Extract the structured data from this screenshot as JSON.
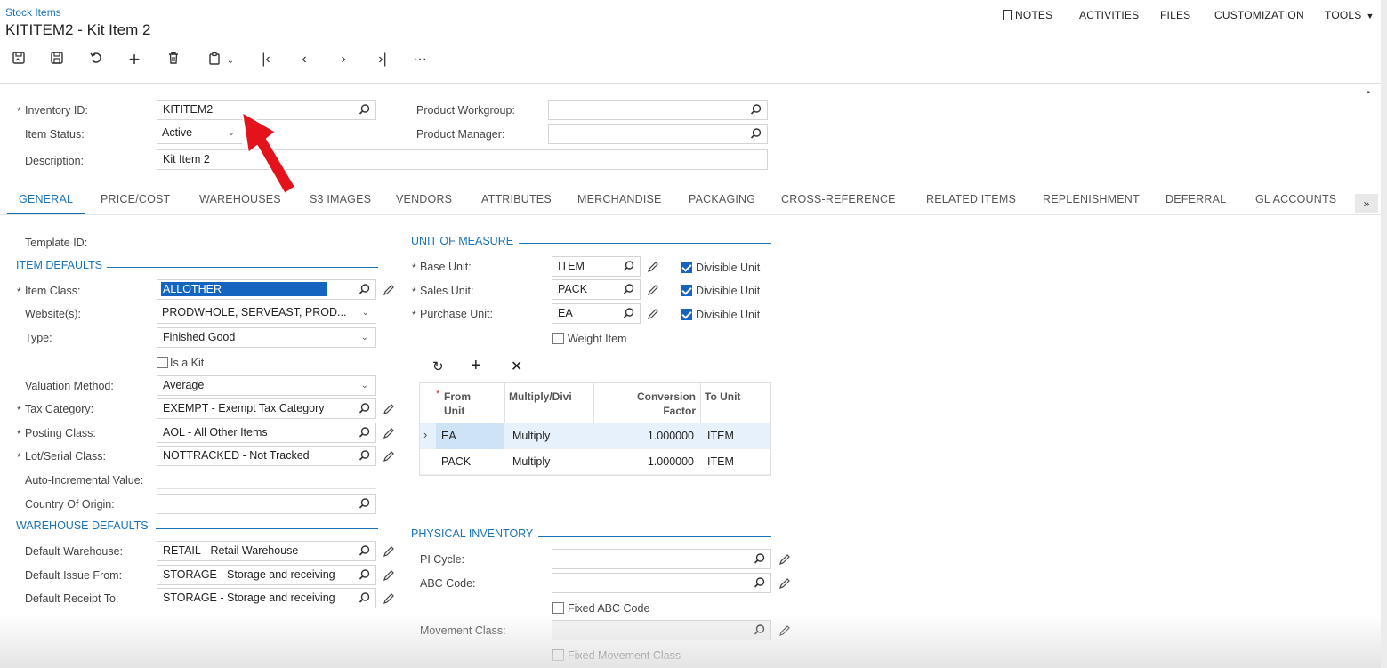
{
  "header": {
    "breadcrumb": "Stock Items",
    "title": "KITITEM2 - Kit Item 2",
    "menu": {
      "notes": "NOTES",
      "activities": "ACTIVITIES",
      "files": "FILES",
      "customization": "CUSTOMIZATION",
      "tools": "TOOLS"
    }
  },
  "summary": {
    "inventory_id_label": "Inventory ID:",
    "inventory_id": "KITITEM2",
    "item_status_label": "Item Status:",
    "item_status": "Active",
    "description_label": "Description:",
    "description": "Kit Item 2",
    "product_workgroup_label": "Product Workgroup:",
    "product_workgroup": "",
    "product_manager_label": "Product Manager:",
    "product_manager": ""
  },
  "tabs": [
    "GENERAL",
    "PRICE/COST",
    "WAREHOUSES",
    "S3 IMAGES",
    "VENDORS",
    "ATTRIBUTES",
    "MERCHANDISE",
    "PACKAGING",
    "CROSS-REFERENCE",
    "RELATED ITEMS",
    "REPLENISHMENT",
    "DEFERRAL",
    "GL ACCOUNTS"
  ],
  "general": {
    "template_id_label": "Template ID:",
    "item_defaults_title": "ITEM DEFAULTS",
    "item_class_label": "Item Class:",
    "item_class": "ALLOTHER",
    "websites_label": "Website(s):",
    "websites": "PRODWHOLE, SERVEAST, PROD...",
    "type_label": "Type:",
    "type": "Finished Good",
    "is_kit_label": "Is a Kit",
    "valuation_method_label": "Valuation Method:",
    "valuation_method": "Average",
    "tax_category_label": "Tax Category:",
    "tax_category": "EXEMPT - Exempt Tax Category",
    "posting_class_label": "Posting Class:",
    "posting_class": "AOL - All Other Items",
    "lot_serial_class_label": "Lot/Serial Class:",
    "lot_serial_class": "NOTTRACKED - Not Tracked",
    "auto_incremental_label": "Auto-Incremental Value:",
    "country_of_origin_label": "Country Of Origin:",
    "country_of_origin": "",
    "warehouse_defaults_title": "WAREHOUSE DEFAULTS",
    "default_warehouse_label": "Default Warehouse:",
    "default_warehouse": "RETAIL - Retail Warehouse",
    "default_issue_label": "Default Issue From:",
    "default_issue": "STORAGE - Storage and receiving",
    "default_receipt_label": "Default Receipt To:",
    "default_receipt": "STORAGE - Storage and receiving"
  },
  "uom": {
    "title": "UNIT OF MEASURE",
    "base_unit_label": "Base Unit:",
    "base_unit": "ITEM",
    "sales_unit_label": "Sales Unit:",
    "sales_unit": "PACK",
    "purchase_unit_label": "Purchase Unit:",
    "purchase_unit": "EA",
    "divisible_label": "Divisible Unit",
    "weight_item_label": "Weight Item",
    "grid": {
      "headers": {
        "from_unit_1": "From",
        "from_unit_2": "Unit",
        "multiply": "Multiply/Divi",
        "conv_1": "Conversion",
        "conv_2": "Factor",
        "to_unit": "To Unit"
      },
      "rows": [
        {
          "from": "EA",
          "multiply": "Multiply",
          "factor": "1.000000",
          "to": "ITEM"
        },
        {
          "from": "PACK",
          "multiply": "Multiply",
          "factor": "1.000000",
          "to": "ITEM"
        }
      ]
    }
  },
  "physical": {
    "title": "PHYSICAL INVENTORY",
    "pi_cycle_label": "PI Cycle:",
    "pi_cycle": "",
    "abc_code_label": "ABC Code:",
    "abc_code": "",
    "fixed_abc_label": "Fixed ABC Code",
    "movement_class_label": "Movement Class:",
    "movement_class": "",
    "fixed_movement_label": "Fixed Movement Class"
  },
  "colors": {
    "accent": "#1a73b7",
    "selection": "#1565c0",
    "annotation_arrow": "#e3121b"
  }
}
